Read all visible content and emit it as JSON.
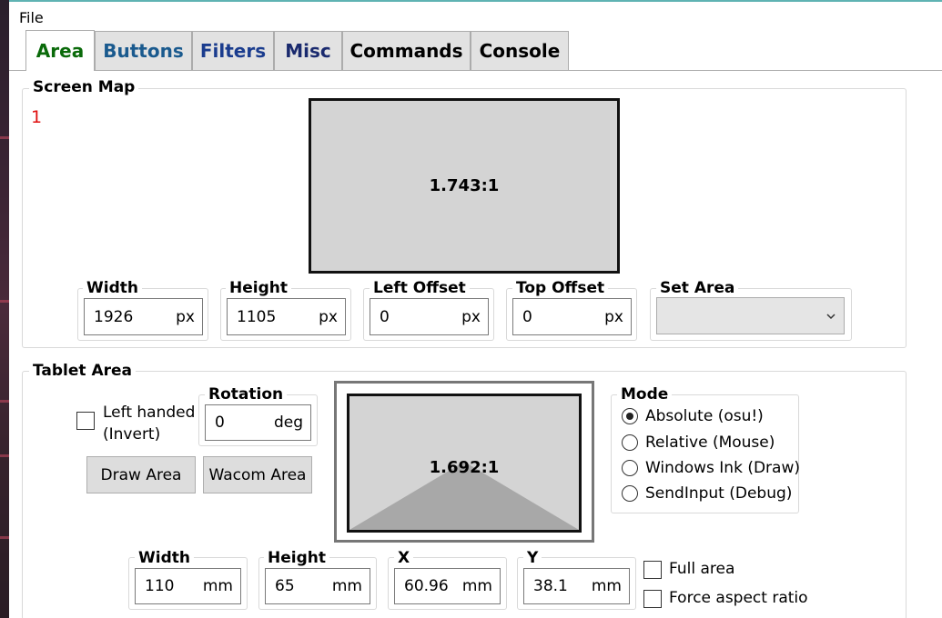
{
  "menu": {
    "file": "File"
  },
  "tabs": [
    {
      "label": "Area",
      "color": "#0a6a0a"
    },
    {
      "label": "Buttons",
      "color": "#1a5a8e"
    },
    {
      "label": "Filters",
      "color": "#1a3c8e"
    },
    {
      "label": "Misc",
      "color": "#1a2a6e"
    },
    {
      "label": "Commands",
      "color": "#000000"
    },
    {
      "label": "Console",
      "color": "#000000"
    }
  ],
  "screen_map": {
    "title": "Screen Map",
    "monitor_index": "1",
    "ratio": "1.743:1",
    "width": {
      "label": "Width",
      "value": "1926",
      "unit": "px"
    },
    "height": {
      "label": "Height",
      "value": "1105",
      "unit": "px"
    },
    "left_offset": {
      "label": "Left Offset",
      "value": "0",
      "unit": "px"
    },
    "top_offset": {
      "label": "Top Offset",
      "value": "0",
      "unit": "px"
    },
    "set_area": {
      "label": "Set Area",
      "value": ""
    }
  },
  "tablet_area": {
    "title": "Tablet Area",
    "left_handed": {
      "label_line1": "Left handed",
      "label_line2": "(Invert)",
      "checked": false
    },
    "rotation": {
      "label": "Rotation",
      "value": "0",
      "unit": "deg"
    },
    "draw_area": "Draw Area",
    "wacom_area": "Wacom Area",
    "ratio": "1.692:1",
    "mode": {
      "label": "Mode",
      "options": [
        "Absolute (osu!)",
        "Relative (Mouse)",
        "Windows Ink (Draw)",
        "SendInput (Debug)"
      ],
      "selected": 0
    },
    "width": {
      "label": "Width",
      "value": "110",
      "unit": "mm"
    },
    "height": {
      "label": "Height",
      "value": "65",
      "unit": "mm"
    },
    "x": {
      "label": "X",
      "value": "60.96",
      "unit": "mm"
    },
    "y": {
      "label": "Y",
      "value": "38.1",
      "unit": "mm"
    },
    "full_area": "Full area",
    "force_aspect": "Force aspect ratio"
  }
}
